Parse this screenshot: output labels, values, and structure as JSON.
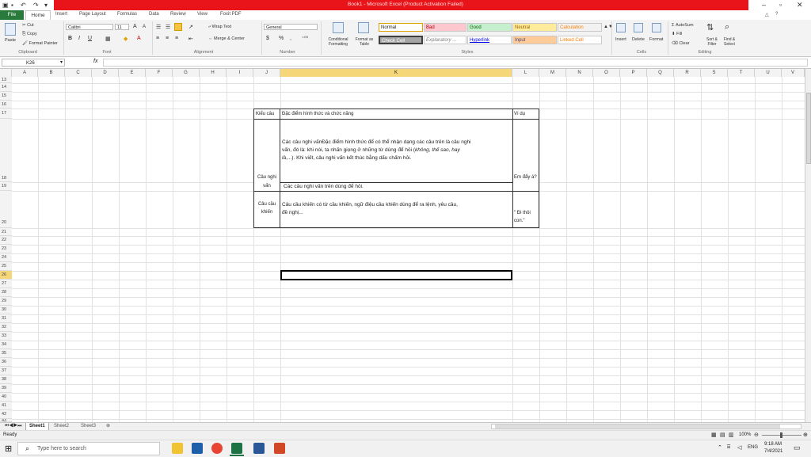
{
  "title": "Book1 - Microsoft Excel (Product Activation Failed)",
  "window": {
    "minimize": "–",
    "restore": "▫",
    "close": "✕"
  },
  "tabs": [
    "File",
    "Home",
    "Insert",
    "Page Layout",
    "Formulas",
    "Data",
    "Review",
    "View",
    "Foxit PDF"
  ],
  "clipboard": {
    "paste": "Paste",
    "cut": "Cut",
    "copy": "Copy",
    "format_painter": "Format Painter",
    "group": "Clipboard"
  },
  "font": {
    "name": "Calibri",
    "size": "11",
    "group": "Font",
    "grow": "A",
    "shrink": "A",
    "bold": "B",
    "italic": "I",
    "underline": "U"
  },
  "alignment": {
    "wrap": "Wrap Text",
    "merge": "Merge & Center",
    "group": "Alignment"
  },
  "number": {
    "format": "General",
    "currency": "$",
    "percent": "%",
    "comma": ",",
    "group": "Number"
  },
  "styles": {
    "conditional": "Conditional Formatting",
    "format_table": "Format as Table",
    "group": "Styles",
    "normal": "Normal",
    "bad": "Bad",
    "good": "Good",
    "neutral": "Neutral",
    "calculation": "Calculation",
    "check": "Check Cell",
    "explanatory": "Explanatory ...",
    "hyperlink": "Hyperlink",
    "input": "Input",
    "linked": "Linked Cell"
  },
  "cells_group": {
    "insert": "Insert",
    "delete": "Delete",
    "format": "Format",
    "group": "Cells"
  },
  "editing": {
    "autosum": "AutoSum",
    "fill": "Fill",
    "clear": "Clear",
    "sort": "Sort & Filter",
    "find": "Find & Select",
    "group": "Editing"
  },
  "formula_bar": {
    "name_box": "K26",
    "fx": "fx",
    "value": ""
  },
  "columns": [
    "A",
    "B",
    "C",
    "D",
    "E",
    "F",
    "G",
    "H",
    "I",
    "J",
    "K",
    "L",
    "M",
    "N",
    "O",
    "P",
    "Q",
    "R",
    "S",
    "T",
    "U",
    "V"
  ],
  "rows": [
    "13",
    "14",
    "15",
    "16",
    "17",
    "18",
    "19",
    "20",
    "21",
    "22",
    "23",
    "24",
    "25",
    "26",
    "27",
    "28",
    "29",
    "30",
    "31",
    "32",
    "33",
    "34",
    "35",
    "36",
    "37",
    "38",
    "39",
    "40",
    "41",
    "42",
    "43"
  ],
  "table": {
    "h_kieu": "Kiểu câu",
    "h_dac": "Đặc điểm hình thức và chức năng",
    "h_vidu": "Ví dụ",
    "r1_kieu_a": "Câu nghi",
    "r1_kieu_b": "vấn",
    "r1_dac_a": "Các câu nghi vấnĐặc điểm hình thức để có thể nhận dạng các câu trên là câu nghi",
    "r1_dac_b": "vấn, đó là: khi nói, ta nhấn giọng ở những từ dùng để hỏi (",
    "r1_dac_b_it": "không, thế sao, hay",
    "r1_dac_c": "là",
    "r1_dac_c_rest": ",...). Khi viết, câu nghi vấn kết thúc bằng dấu chấm hỏi.",
    "r1_vidu": "Em đẩy à?",
    "r2_dac": "Các câu nghi vấn trên dùng để hỏi.",
    "r3_kieu_a": "Câu cầu",
    "r3_kieu_b": "khiến",
    "r3_dac_a": "Câu cầu khiến có từ cầu khiến, ngữ điệu cầu khiến dùng để ra lệnh, yêu cầu,",
    "r3_dac_b": "đề nghị...",
    "r3_vidu_a": "\" Đi thôi",
    "r3_vidu_b": "con.\""
  },
  "sheets": [
    "Sheet1",
    "Sheet2",
    "Sheet3"
  ],
  "status": {
    "ready": "Ready",
    "zoom": "100%"
  },
  "taskbar": {
    "search": "Type here to search",
    "time": "9:18 AM",
    "date": "7/4/2021",
    "lang": "ENG"
  },
  "colors": {
    "titlebar": "#e8141a",
    "file_tab": "#2a7a3b",
    "selected_header": "#f5d77a"
  }
}
